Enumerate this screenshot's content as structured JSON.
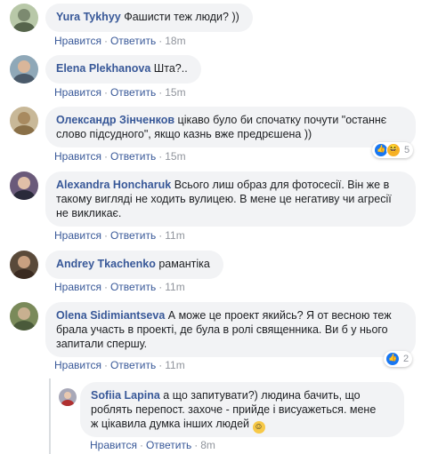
{
  "action_labels": {
    "like": "Нравится",
    "reply": "Ответить",
    "separator": "·"
  },
  "comments": [
    {
      "author": "Yura Tykhyy",
      "text": "Фашисти теж люди? ))",
      "time": "18m"
    },
    {
      "author": "Elena Plekhanova",
      "text": "Шта?..",
      "time": "15m"
    },
    {
      "author": "Олександр Зінченков",
      "text_line1": "цікаво було би спочатку почути \"останнє",
      "text_line2": "слово підсудного\", якщо казнь вже предрєшена ))",
      "time": "15m",
      "reactions": {
        "count": "5",
        "types": [
          "like",
          "haha"
        ]
      }
    },
    {
      "author": "Alexandra Honcharuk",
      "text_line1": "Всього лиш образ для фотосесії. Він же в",
      "text_line2": "такому вигляді не ходить вулицею. В мене це негативу чи агресії",
      "text_line3": "не викликає.",
      "time": "11m"
    },
    {
      "author": "Andrey Tkachenko",
      "text": "рамантіка",
      "time": "11m"
    },
    {
      "author": "Olena Sidimiantseva",
      "text_line1": "А може це проект якийсь? Я от весною теж",
      "text_line2": "брала участь в проекті, де була в ролі священника. Ви б у нього",
      "text_line3": "запитали спершу.",
      "time": "11m",
      "reactions": {
        "count": "2",
        "types": [
          "like"
        ]
      }
    }
  ],
  "reply": {
    "author": "Sofiia Lapina",
    "text_line1": "а що запитувати?) людина бачить, що",
    "text_line2": "роблять перепост. захоче - прийде і висуажеться. мене",
    "text_line3": "ж цікавила думка інших людей",
    "emoji": "smile-emoji-icon",
    "time": "8m"
  },
  "colors": {
    "link": "#385898",
    "bubble": "#f2f3f5",
    "meta": "#90949c",
    "like_blue": "#1877f2"
  }
}
